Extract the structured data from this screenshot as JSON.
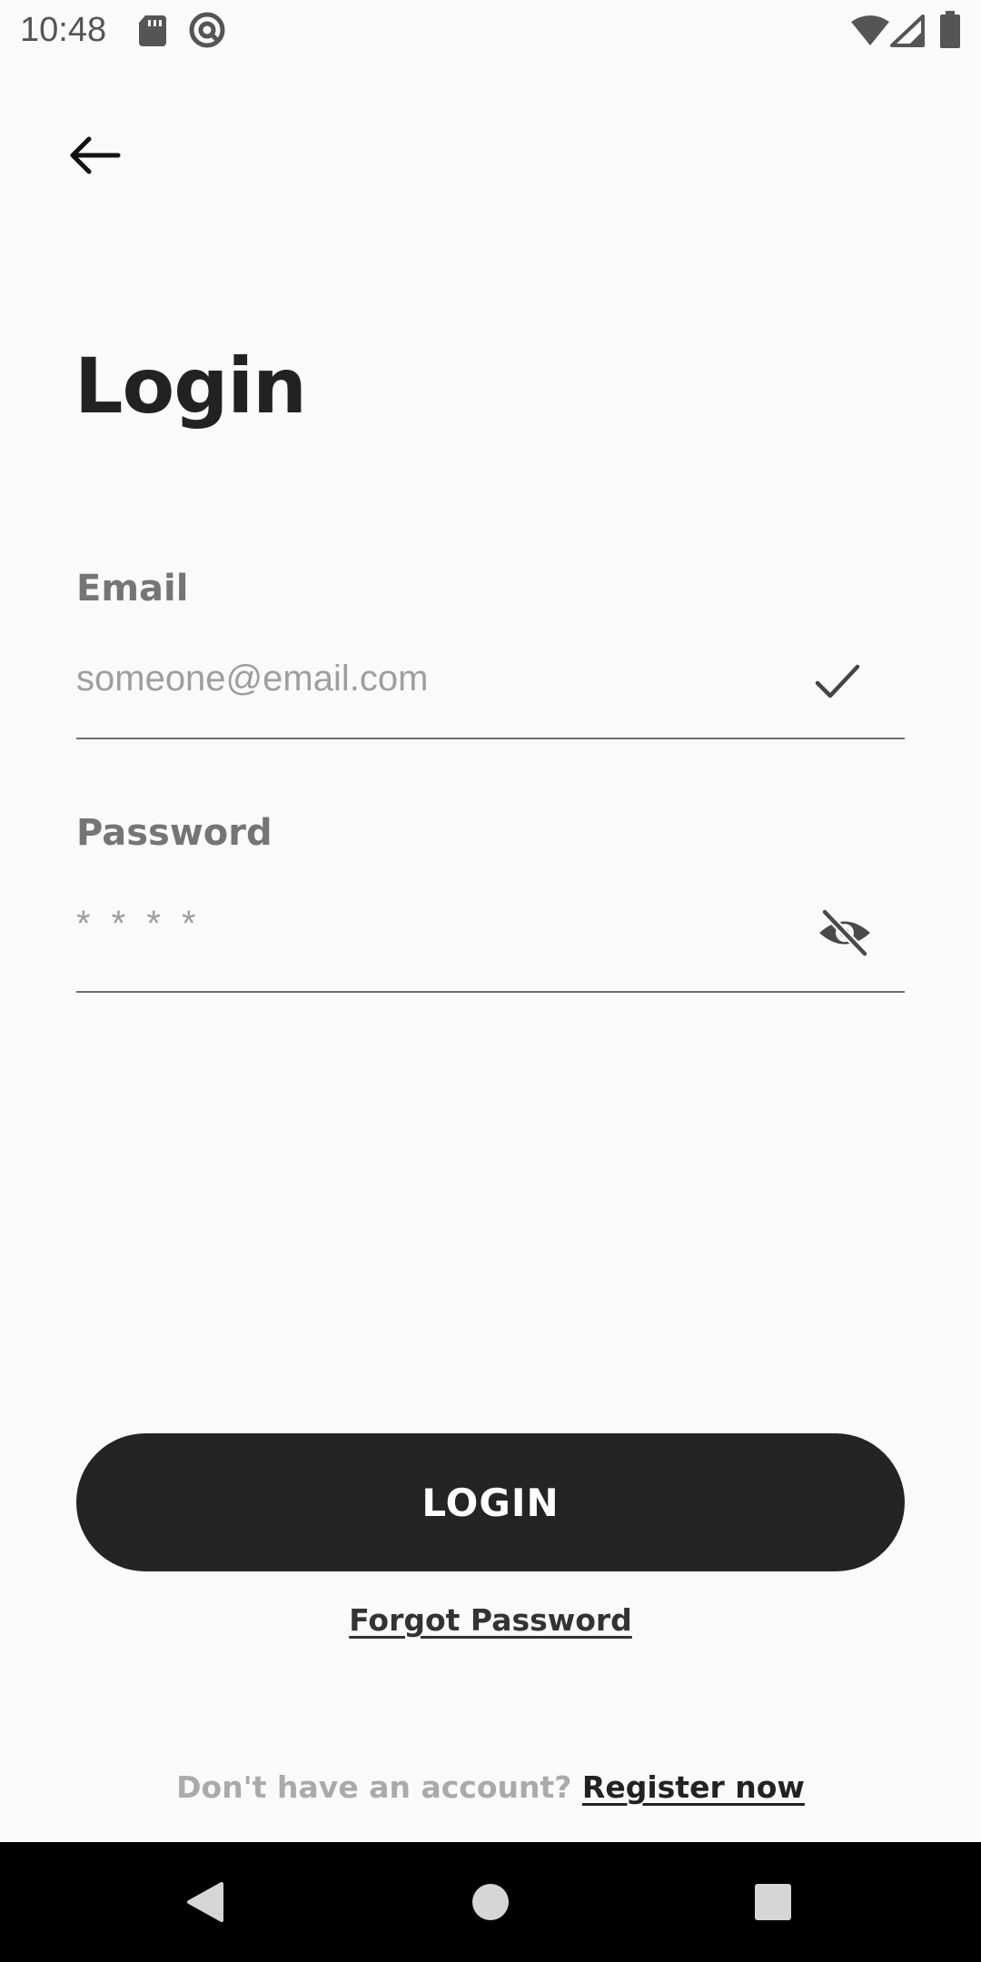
{
  "status_bar": {
    "time": "10:48",
    "left_icons": [
      "sd-card-icon",
      "vpn-key-icon"
    ],
    "right_icons": [
      "wifi-icon",
      "signal-icon",
      "battery-icon"
    ]
  },
  "header": {
    "back_icon": "arrow-left-icon"
  },
  "page": {
    "title": "Login"
  },
  "form": {
    "email": {
      "label": "Email",
      "placeholder": "someone@email.com",
      "value": "",
      "status_icon": "check-icon"
    },
    "password": {
      "label": "Password",
      "placeholder": "* * * *",
      "value": "",
      "toggle_icon": "eye-off-icon"
    }
  },
  "actions": {
    "login_label": "LOGIN",
    "forgot_label": "Forgot Password",
    "register_prompt": "Don't have an account?",
    "register_label": "Register now"
  },
  "nav_bar": {
    "buttons": [
      "back-triangle-icon",
      "home-circle-icon",
      "recents-square-icon"
    ]
  },
  "colors": {
    "background": "#fafafa",
    "primary": "#242424",
    "label_gray": "#757575",
    "placeholder_gray": "#9e9e9e",
    "muted_text": "#aaaaaa"
  }
}
